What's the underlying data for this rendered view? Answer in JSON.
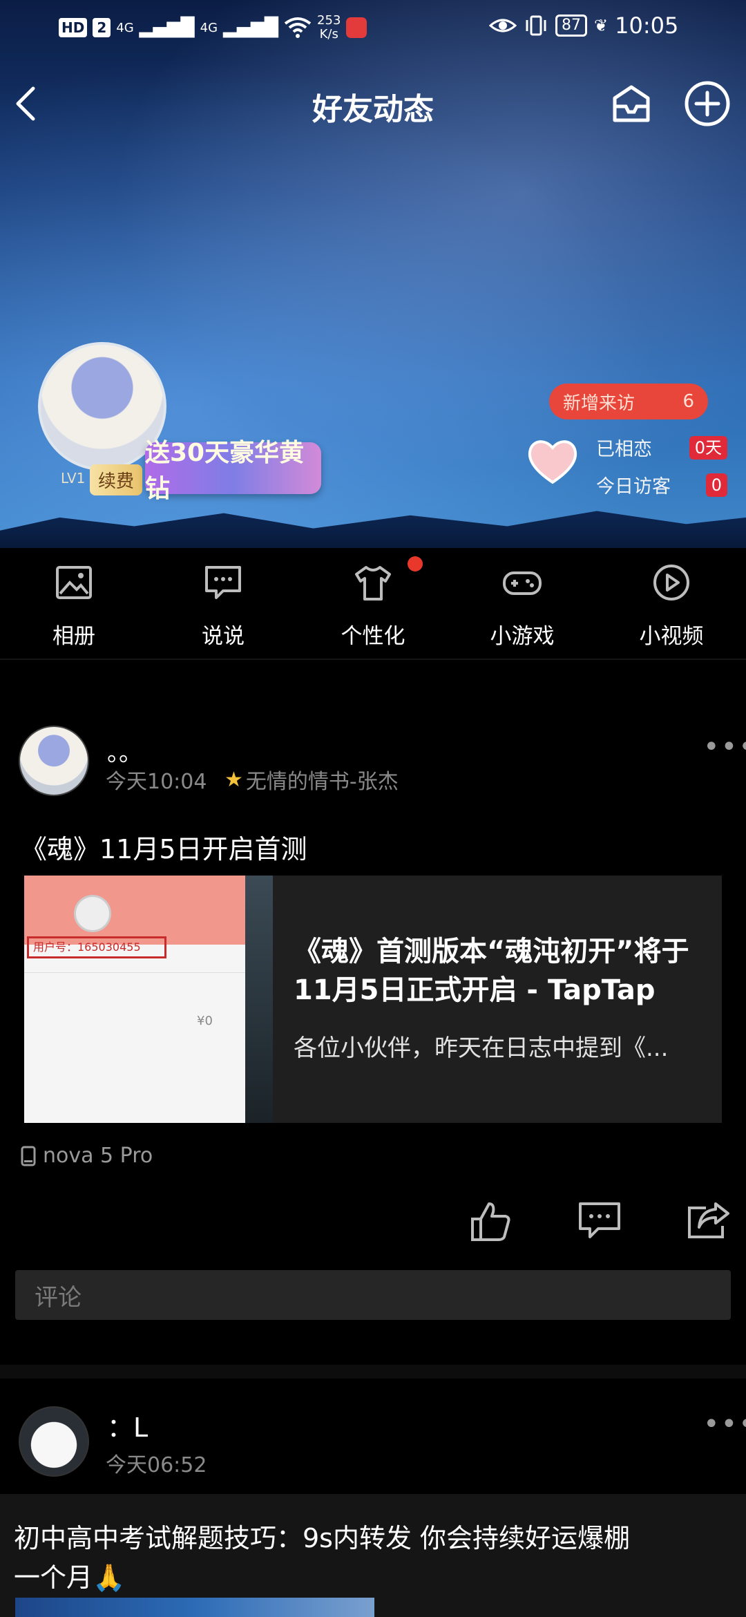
{
  "status_bar": {
    "hd": "HD",
    "sim": "2",
    "net1": "4G",
    "net2": "4G",
    "speed_value": "253",
    "speed_unit": "K/s",
    "battery": "87",
    "time": "10:05"
  },
  "header": {
    "title": "好友动态"
  },
  "profile": {
    "level": "LV1",
    "renew_label": "续费",
    "vip_banner": "送30天豪华黄钻",
    "new_visitors_label": "新增来访",
    "new_visitors_count": "6",
    "love_label": "已相恋",
    "love_value": "0天",
    "today_visitors_label": "今日访客",
    "today_visitors_value": "0"
  },
  "nav": {
    "items": [
      {
        "label": "相册",
        "icon": "photo-icon"
      },
      {
        "label": "说说",
        "icon": "chat-bubble-icon"
      },
      {
        "label": "个性化",
        "icon": "tshirt-icon"
      },
      {
        "label": "小游戏",
        "icon": "gamepad-icon"
      },
      {
        "label": "小视频",
        "icon": "play-circle-icon"
      }
    ]
  },
  "posts": [
    {
      "name": "。。",
      "time": "今天10:04",
      "song": "无情的情书-张杰",
      "text": "《魂》11月5日开启首测",
      "card_title": "《魂》首测版本“魂沌初开”将于11月5日正式开启 - TapTap",
      "card_desc": "各位小伙伴，昨天在日志中提到《...",
      "thumb_user_id": "用户号：165030455",
      "thumb_price": "¥0",
      "device": "nova 5 Pro",
      "comment_placeholder": "评论"
    },
    {
      "name": "：L",
      "time": "今天06:52",
      "text_line1": "初中高中考试解题技巧：9s内转发 你会持续好运爆棚",
      "text_line2": "一个月🙏"
    }
  ]
}
